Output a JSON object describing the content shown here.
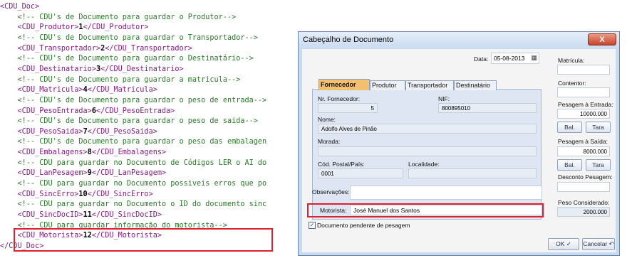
{
  "xml": {
    "lines": [
      {
        "indent": "",
        "open": "<CDU_Doc>",
        "value": "",
        "close": "",
        "comment": ""
      },
      {
        "indent": "    ",
        "open": "",
        "value": "",
        "close": "",
        "comment": "<!-- CDU's de Documento para guardar o Produtor-->"
      },
      {
        "indent": "    ",
        "open": "<CDU_Produtor>",
        "value": "1",
        "close": "</CDU_Produtor>",
        "comment": ""
      },
      {
        "indent": "    ",
        "open": "",
        "value": "",
        "close": "",
        "comment": "<!-- CDU's de Documento para guardar o Transportador-->"
      },
      {
        "indent": "    ",
        "open": "<CDU_Transportador>",
        "value": "2",
        "close": "</CDU_Transportador>",
        "comment": ""
      },
      {
        "indent": "    ",
        "open": "",
        "value": "",
        "close": "",
        "comment": "<!-- CDU's de Documento para guardar o Destinatário-->"
      },
      {
        "indent": "    ",
        "open": "<CDU_Destinatario>",
        "value": "3",
        "close": "</CDU_Destinatario>",
        "comment": ""
      },
      {
        "indent": "    ",
        "open": "",
        "value": "",
        "close": "",
        "comment": "<!-- CDU's de Documento para guardar a matricula-->"
      },
      {
        "indent": "    ",
        "open": "<CDU_Matricula>",
        "value": "4",
        "close": "</CDU_Matricula>",
        "comment": ""
      },
      {
        "indent": "    ",
        "open": "",
        "value": "",
        "close": "",
        "comment": "<!-- CDU's de Documento para guardar o peso de entrada-->"
      },
      {
        "indent": "    ",
        "open": "<CDU_PesoEntrada>",
        "value": "6",
        "close": "</CDU_PesoEntrada>",
        "comment": ""
      },
      {
        "indent": "    ",
        "open": "",
        "value": "",
        "close": "",
        "comment": "<!-- CDU's de Documento para guardar o peso de saida-->"
      },
      {
        "indent": "    ",
        "open": "<CDU_PesoSaida>",
        "value": "7",
        "close": "</CDU_PesoSaida>",
        "comment": ""
      },
      {
        "indent": "    ",
        "open": "",
        "value": "",
        "close": "",
        "comment": "<!-- CDU's de Documento para guardar o peso das embalagen"
      },
      {
        "indent": "    ",
        "open": "<CDU_Embalagens>",
        "value": "8",
        "close": "</CDU_Embalagens>",
        "comment": ""
      },
      {
        "indent": "    ",
        "open": "",
        "value": "",
        "close": "",
        "comment": "<!-- CDU para guardar no Documento de Códigos LER o AI do"
      },
      {
        "indent": "    ",
        "open": "<CDU_LanPesagem>",
        "value": "9",
        "close": "</CDU_LanPesagem>",
        "comment": ""
      },
      {
        "indent": "    ",
        "open": "",
        "value": "",
        "close": "",
        "comment": "<!-- CDU para guardar no Documento possiveis erros que po"
      },
      {
        "indent": "    ",
        "open": "<CDU_SincErro>",
        "value": "10",
        "close": "</CDU_SincErro>",
        "comment": ""
      },
      {
        "indent": "    ",
        "open": "",
        "value": "",
        "close": "",
        "comment": "<!-- CDU para guardar no Documento o ID do documento sinc"
      },
      {
        "indent": "    ",
        "open": "<CDU_SincDocID>",
        "value": "11",
        "close": "</CDU_SincDocID>",
        "comment": ""
      },
      {
        "indent": "    ",
        "open": "",
        "value": "",
        "close": "",
        "comment": "<!-- CDU para guardar informação do motorista-->"
      },
      {
        "indent": "    ",
        "open": "<CDU_Motorista>",
        "value": "12",
        "close": "</CDU_Motorista>",
        "comment": ""
      },
      {
        "indent": "",
        "open": "</CDU_Doc>",
        "value": "",
        "close": "",
        "comment": ""
      }
    ]
  },
  "dialog": {
    "title": "Cabeçalho de Documento",
    "close_glyph": "X",
    "data_label": "Data:",
    "data_value": "05-08-2013",
    "calendar_glyph": "▦",
    "tabs": [
      "Fornecedor",
      "Produtor",
      "Transportador",
      "Destinatário"
    ],
    "active_tab": "Fornecedor",
    "nr_fornecedor_label": "Nr. Fornecedor:",
    "nr_fornecedor_value": "5",
    "nif_label": "NIF:",
    "nif_value": "800895010",
    "nome_label": "Nome:",
    "nome_value": "Adolfo Alves de Pinão",
    "morada_label": "Morada:",
    "morada_value": "",
    "cod_postal_label": "Cód. Postal/País:",
    "cod_postal_value": "0001",
    "localidade_label": "Localidade:",
    "localidade_value": "",
    "observacoes_label": "Observações:",
    "observacoes_value": "",
    "motorista_label": "Motorista:",
    "motorista_value": "José Manuel dos Santos",
    "pendente_label": "Documento pendente de pesagem",
    "pendente_checked": true,
    "check_glyph": "✓",
    "right": {
      "matricula_label": "Matrícula:",
      "matricula_value": "",
      "contentor_label": "Contentor:",
      "contentor_value": "",
      "pesagem_entrada_label": "Pesagem à Entrada:",
      "pesagem_entrada_value": "10000.000",
      "pesagem_saida_label": "Pesagem à Saída:",
      "pesagem_saida_value": "8000.000",
      "bal_label": "Bal.",
      "tara_label": "Tara",
      "desconto_label": "Desconto Pesagem:",
      "desconto_value": "",
      "peso_considerado_label": "Peso Considerado:",
      "peso_considerado_value": "2000.000"
    },
    "ok_label": "OK ✓",
    "cancelar_label": "Cancelar ↶"
  }
}
